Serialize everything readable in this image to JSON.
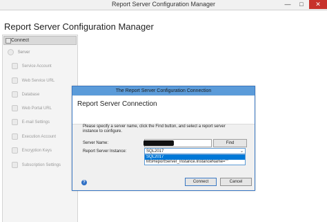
{
  "window": {
    "title": "Report Server Configuration Manager",
    "min_glyph": "—",
    "max_glyph": "□",
    "close_glyph": "✕"
  },
  "app": {
    "title": "Report Server Configuration Manager"
  },
  "sidebar": {
    "connect": "Connect",
    "server": "Server",
    "items": [
      {
        "label": "Service Account",
        "icon": "service-account-icon"
      },
      {
        "label": "Web Service URL",
        "icon": "web-service-icon"
      },
      {
        "label": "Database",
        "icon": "database-icon"
      },
      {
        "label": "Web Portal URL",
        "icon": "web-portal-icon"
      },
      {
        "label": "E-mail Settings",
        "icon": "email-icon"
      },
      {
        "label": "Execution Account",
        "icon": "execution-account-icon"
      },
      {
        "label": "Encryption Keys",
        "icon": "encryption-keys-icon"
      },
      {
        "label": "Subscription Settings",
        "icon": "subscription-icon"
      }
    ]
  },
  "dialog": {
    "title": "The Report Server Configuration Connection",
    "heading": "Report Server Connection",
    "description": "Please specify a server name, click the Find button, and select a report server instance to configure.",
    "server_label": "Server Name:",
    "server_value": "",
    "find_button": "Find",
    "instance_label": "Report Server Instance:",
    "instance_selected": "SQL2017",
    "instance_options": [
      "SQL2017",
      "MSReportServer_Instance.InstanceName=\"\""
    ],
    "connect_button": "Connect",
    "cancel_button": "Cancel",
    "help_glyph": "?"
  },
  "colors": {
    "dialog_border": "#3a78c3",
    "dialog_titlebar": "#5b9bd9",
    "selection": "#0078d7",
    "close_button": "#c7312b"
  }
}
